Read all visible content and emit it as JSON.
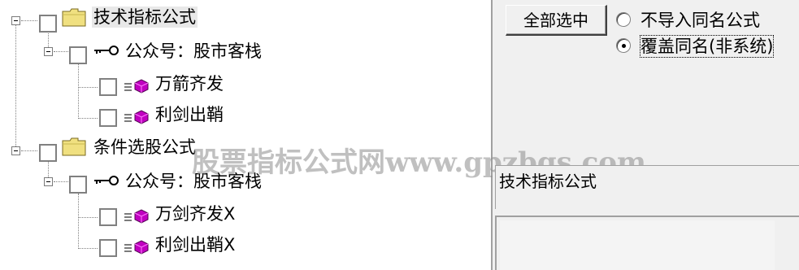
{
  "tree": {
    "root1": {
      "label": "技术指标公式"
    },
    "pub1": {
      "label": "公众号：股市客栈"
    },
    "item1": {
      "label": "万箭齐发"
    },
    "item2": {
      "label": "利剑出鞘"
    },
    "root2": {
      "label": "条件选股公式"
    },
    "pub2": {
      "label": "公众号：股市客栈"
    },
    "item3": {
      "label": "万剑齐发X"
    },
    "item4": {
      "label": "利剑出鞘X"
    }
  },
  "watermark": "股票指标公式网www.gpzbgs.com",
  "controls": {
    "select_all_label": "全部选中",
    "radio_skip_label": "不导入同名公式",
    "radio_skip_selected": false,
    "radio_overwrite_label": "覆盖同名(非系统)",
    "radio_overwrite_selected": true
  },
  "formula_name": "技术指标公式",
  "colors": {
    "folder": "#f0e080",
    "formula_icon": "#c000c0",
    "tree_bg": "#ffffff",
    "panel_bg": "#f0f0f0"
  }
}
